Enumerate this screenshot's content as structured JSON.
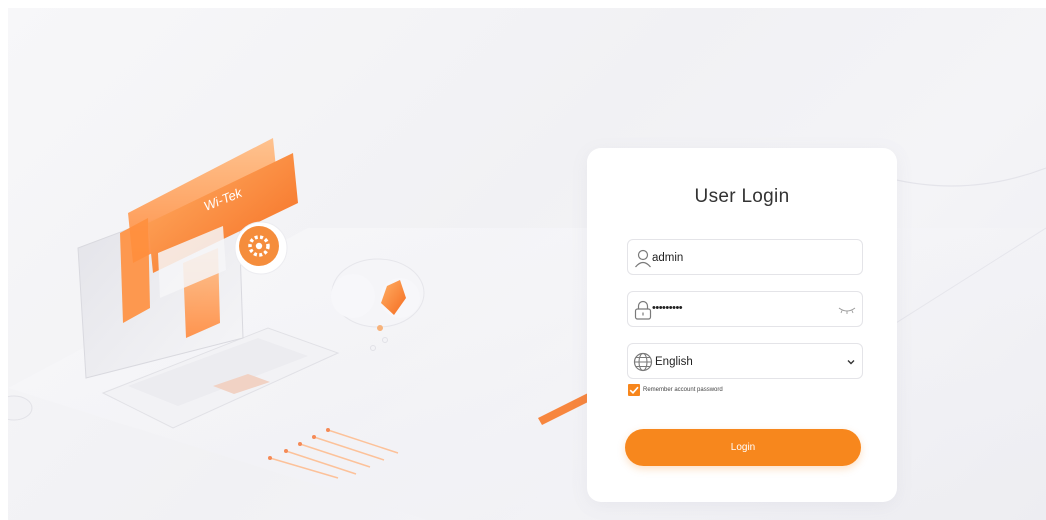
{
  "illustration": {
    "brand_logo_text": "Wi-Tek"
  },
  "login": {
    "title": "User Login",
    "username_value": "admin",
    "password_mask": "•••••••••",
    "language_value": "English",
    "remember_label": "Remember account password",
    "remember_checked": true,
    "login_button_label": "Login"
  },
  "icons": {
    "username": "user-icon",
    "password": "lock-icon",
    "show_password": "eye-closed-icon",
    "language": "globe-icon",
    "dropdown": "chevron-down-icon",
    "checkbox": "check-icon"
  },
  "colors": {
    "accent": "#f7871d",
    "background": "#f3f3f6",
    "card": "#ffffff",
    "title_text": "#333333"
  }
}
